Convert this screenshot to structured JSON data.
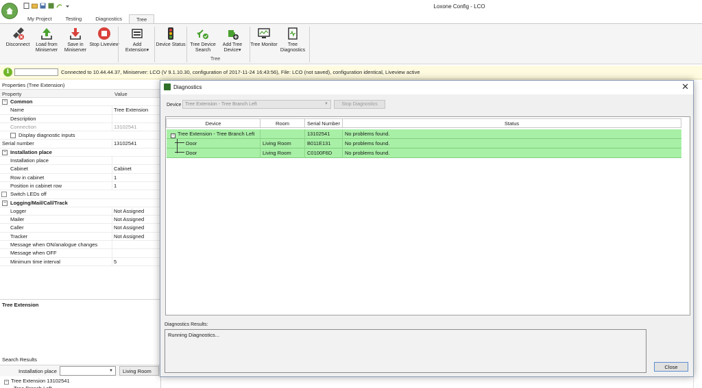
{
  "app": {
    "title": "Loxone Config - LCO"
  },
  "tabs": [
    {
      "label": "My Project"
    },
    {
      "label": "Testing"
    },
    {
      "label": "Diagnostics"
    },
    {
      "label": "Tree"
    }
  ],
  "ribbon": {
    "buttons": [
      {
        "label": "Disconnect",
        "icon": "disconnect-icon"
      },
      {
        "label": "Load from Miniserver",
        "icon": "upload-icon"
      },
      {
        "label": "Save in Miniserver",
        "icon": "download-icon"
      },
      {
        "label": "Stop Liveview",
        "icon": "stop-icon"
      },
      {
        "label": "Add Extension",
        "icon": "add-extension-icon"
      },
      {
        "label": "Device Status",
        "icon": "traffic-light-icon"
      },
      {
        "label": "Tree Device Search",
        "icon": "tree-search-icon"
      },
      {
        "label": "Add Tree Device",
        "icon": "add-tree-device-icon"
      },
      {
        "label": "Tree Monitor",
        "icon": "monitor-icon"
      },
      {
        "label": "Tree Diagnostics",
        "icon": "diagnostics-icon"
      }
    ],
    "group_label": "Tree",
    "colors": {
      "green": "#4aa12f",
      "red": "#d9413b"
    }
  },
  "status": {
    "text": "Connected to 10.44.44.37, Miniserver: LCO (V 9.1.10.30, configuration of 2017-11-24 16:43:56), File: LCO (not saved), configuration identical, Liveview active"
  },
  "properties": {
    "panel_title": "Properties (Tree Extension)",
    "col_property": "Property",
    "col_value": "Value",
    "rows": [
      {
        "name": "Common",
        "value": "",
        "type": "category"
      },
      {
        "name": "Name",
        "value": "Tree Extension",
        "type": "field"
      },
      {
        "name": "Description",
        "value": "",
        "type": "field"
      },
      {
        "name": "Connection",
        "value": "13102541",
        "type": "disabled"
      },
      {
        "name": "Display diagnostic inputs",
        "value": "",
        "type": "checkbox"
      },
      {
        "name": "Serial number",
        "value": "13102541",
        "type": "plain"
      },
      {
        "name": "Installation place",
        "value": "",
        "type": "category"
      },
      {
        "name": "Installation place",
        "value": "",
        "type": "field"
      },
      {
        "name": "Cabinet",
        "value": "Cabinet",
        "type": "field"
      },
      {
        "name": "Row in cabinet",
        "value": "1",
        "type": "field"
      },
      {
        "name": "Position in cabinet row",
        "value": "1",
        "type": "field"
      },
      {
        "name": "Switch LEDs off",
        "value": "",
        "type": "checkbox-left"
      },
      {
        "name": "Logging/Mail/Call/Track",
        "value": "",
        "type": "category"
      },
      {
        "name": "Logger",
        "value": "Not Assigned",
        "type": "field"
      },
      {
        "name": "Mailer",
        "value": "Not Assigned",
        "type": "field"
      },
      {
        "name": "Caller",
        "value": "Not Assigned",
        "type": "field"
      },
      {
        "name": "Tracker",
        "value": "Not Assigned",
        "type": "field"
      },
      {
        "name": "Message when ON/analogue changes",
        "value": "",
        "type": "field"
      },
      {
        "name": "Message when OFF",
        "value": "",
        "type": "field"
      },
      {
        "name": "Minimum time interval",
        "value": "5",
        "type": "field"
      }
    ],
    "description_title": "Tree Extension"
  },
  "search": {
    "title": "Search Results",
    "label": "Installation place",
    "combo_value": "",
    "room_value": "Living Room",
    "tree_item": "Tree Extension 13102541",
    "tree_child": "Tree Branch Left"
  },
  "dialog": {
    "title": "Diagnostics",
    "device_label": "Device",
    "device_value": "Tree Extension - Tree Branch Left",
    "stop_button": "Stop Diagnostics",
    "columns": [
      "Device",
      "Room",
      "Serial Number",
      "Status"
    ],
    "rows": [
      {
        "device": "Tree Extension - Tree Branch Left",
        "room": "",
        "serial": "13102541",
        "status": "No problems found.",
        "level": 0
      },
      {
        "device": "Door",
        "room": "Living Room",
        "serial": "B011E131",
        "status": "No problems found.",
        "level": 1
      },
      {
        "device": "Door",
        "room": "Living Room",
        "serial": "C0100F6D",
        "status": "No problems found.",
        "level": 1
      }
    ],
    "results_label": "Diagnostics Results:",
    "results_text": "Running Diagnostics...",
    "close_button": "Close",
    "ok_color": "#a8f0a6"
  }
}
